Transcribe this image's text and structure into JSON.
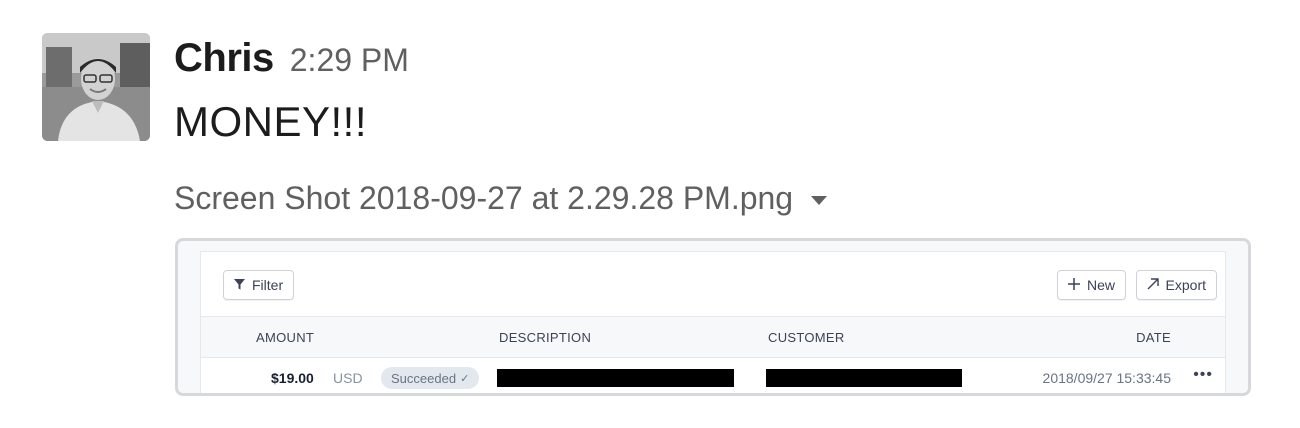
{
  "message": {
    "author": "Chris",
    "timestamp": "2:29 PM",
    "text": "MONEY!!!",
    "file_name": "Screen Shot 2018-09-27 at 2.29.28 PM.png"
  },
  "attachment": {
    "toolbar": {
      "filter_label": "Filter",
      "new_label": "New",
      "export_label": "Export"
    },
    "table": {
      "columns": [
        "AMOUNT",
        "DESCRIPTION",
        "CUSTOMER",
        "DATE"
      ],
      "rows": [
        {
          "amount": "$19.00",
          "currency": "USD",
          "status": "Succeeded",
          "date": "2018/09/27 15:33:45",
          "more": "•••"
        }
      ]
    }
  },
  "icons": {
    "filter": "filter-icon",
    "new": "plus-icon",
    "export": "arrow-up-right-icon",
    "caret": "caret-down-icon",
    "check": "check-icon"
  }
}
